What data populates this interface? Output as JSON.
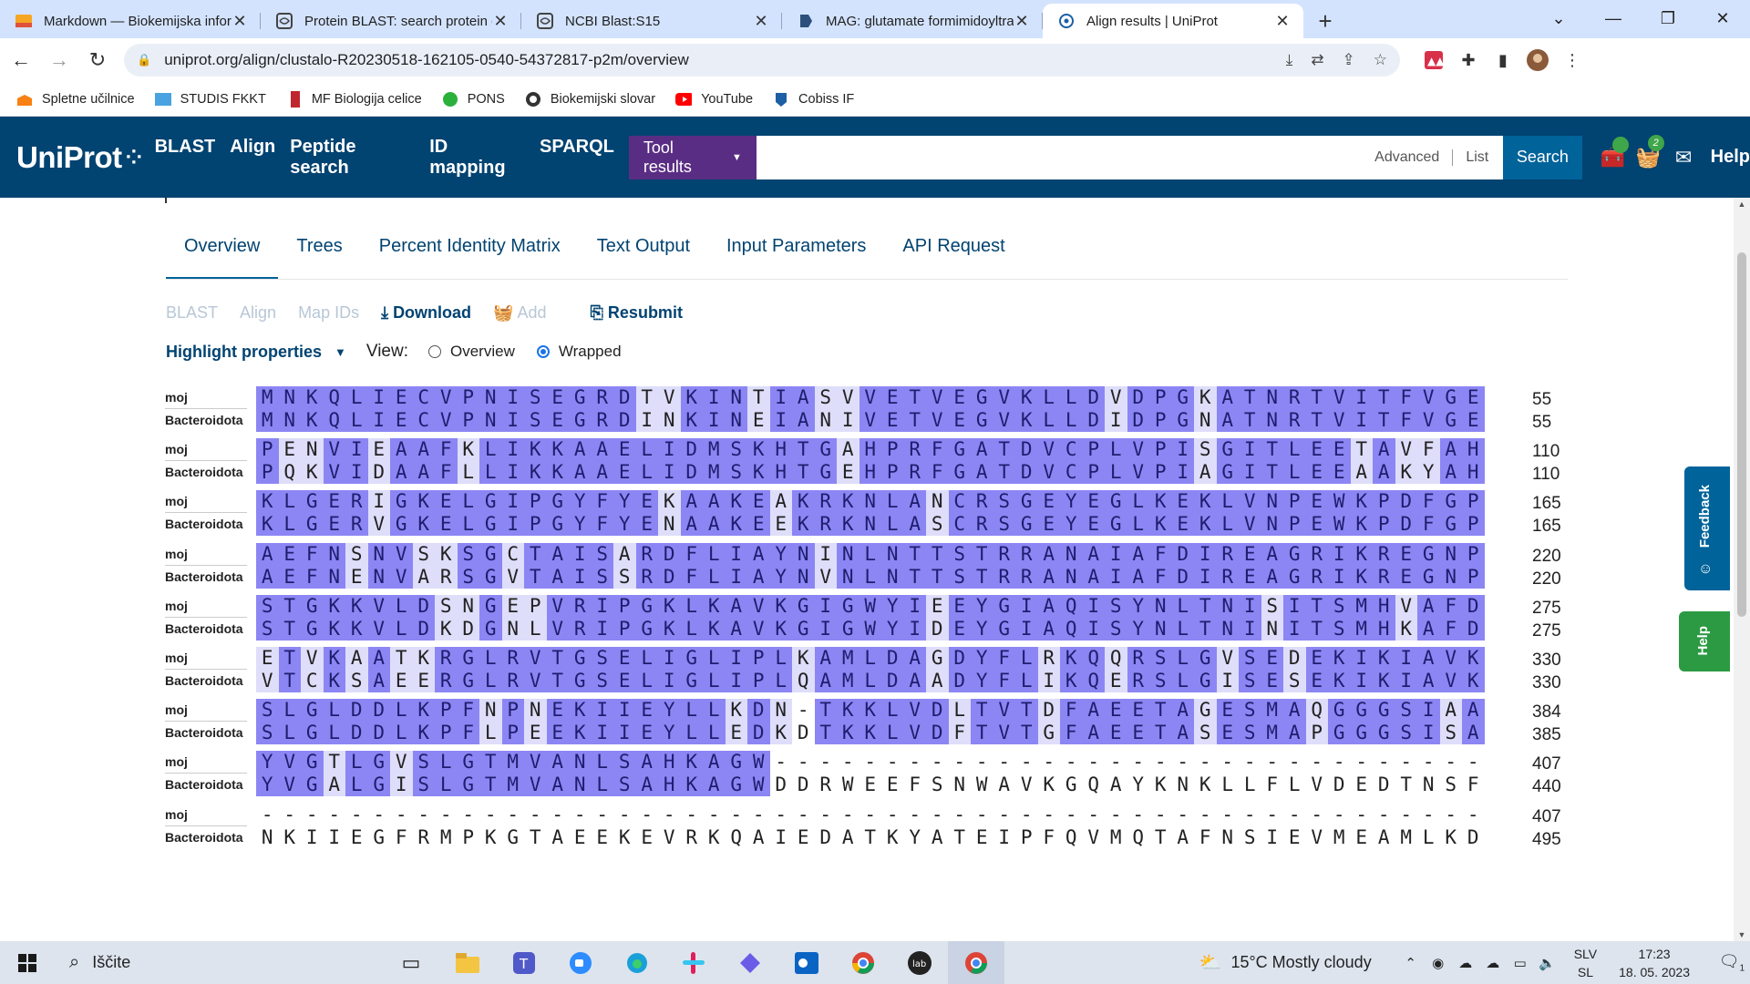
{
  "browser": {
    "tabs": [
      {
        "title": "Markdown — Biokemijska inform",
        "icon": "markdown-icon",
        "active": false
      },
      {
        "title": "Protein BLAST: search protein da",
        "icon": "ncbi-icon",
        "active": false
      },
      {
        "title": "NCBI Blast:S15",
        "icon": "ncbi-icon",
        "active": false
      },
      {
        "title": "MAG: glutamate formimidoyltran",
        "icon": "document-icon",
        "active": false
      },
      {
        "title": "Align results | UniProt",
        "icon": "uniprot-icon",
        "active": true
      }
    ],
    "url": "uniprot.org/align/clustalo-R20230518-162105-0540-54372817-p2m/overview",
    "bookmarks": [
      {
        "label": "Spletne učilnice",
        "icon": "moodle-icon"
      },
      {
        "label": "STUDIS FKKT",
        "icon": "folder-icon"
      },
      {
        "label": "MF Biologija celice",
        "icon": "bookmark-icon"
      },
      {
        "label": "PONS",
        "icon": "pons-icon"
      },
      {
        "label": "Biokemijski slovar",
        "icon": "globe-icon"
      },
      {
        "label": "YouTube",
        "icon": "youtube-icon"
      },
      {
        "label": "Cobiss IF",
        "icon": "cobiss-icon"
      }
    ]
  },
  "uniprot": {
    "logo": "UniProt",
    "nav": [
      "BLAST",
      "Align",
      "Peptide search",
      "ID mapping",
      "SPARQL"
    ],
    "tool_results": "Tool results",
    "search_links": [
      "Advanced",
      "List"
    ],
    "search_button": "Search",
    "basket_count": "2",
    "help": "Help"
  },
  "page": {
    "subtabs": [
      "Overview",
      "Trees",
      "Percent Identity Matrix",
      "Text Output",
      "Input Parameters",
      "API Request"
    ],
    "actions": [
      {
        "label": "BLAST",
        "enabled": false
      },
      {
        "label": "Align",
        "enabled": false
      },
      {
        "label": "Map IDs",
        "enabled": false
      },
      {
        "label": "Download",
        "enabled": true,
        "icon": "download-icon"
      },
      {
        "label": "Add",
        "enabled": false,
        "icon": "basket-icon"
      },
      {
        "label": "Resubmit",
        "enabled": true,
        "icon": "resubmit-icon"
      }
    ],
    "highlight": "Highlight properties",
    "view_label": "View:",
    "view_options": [
      {
        "label": "Overview",
        "selected": false
      },
      {
        "label": "Wrapped",
        "selected": true
      }
    ],
    "feedback": "Feedback",
    "help_tab": "Help"
  },
  "alignment": {
    "names": [
      "moj",
      "Bacteroidota"
    ],
    "blocks": [
      {
        "a": "MNKQLIECVPNISEGRDTVKINTIASVVETVEGVKLLDVDPGKATNRTVITFVGE",
        "b": "MNKQLIECVPNISEGRDINKINEIANIVETVEGVKLLDIDPGNATNRTVITFVGE",
        "na": "55",
        "nb": "55"
      },
      {
        "a": "PENVIEAAFKLIKKAAELIDMSKHTGAHPRFGATDVCPLVPISGITLEETAVFAH",
        "b": "PQKVIDAAFLLIKKAAELIDMSKHTGEHPRFGATDVCPLVPIAGITLEEAAKYAH",
        "na": "110",
        "nb": "110"
      },
      {
        "a": "KLGERIGKELGIPGYFYEKAAKEAKRKNLANCRSGEYEGLKEKLVNPEWKPDFGP",
        "b": "KLGERVGKELGIPGYFYENAAKEEKRKNLASCRSGEYEGLKEKLVNPEWKPDFGP",
        "na": "165",
        "nb": "165"
      },
      {
        "a": "AEFNSNVSKSGCTAISARDFLIAYNINLNTTSTRRANAIAFDIREAGRIKREGNP",
        "b": "AEFNENVARSGVTAISSRDFLIAYNVNLNTTSTRRANAIAFDIREAGRIKREGNP",
        "na": "220",
        "nb": "220"
      },
      {
        "a": "STGKKVLDSNGEPVRIPGKLKAVKGIGWYIEEYGIAQISYNLTNISITSMHVAFD",
        "b": "STGKKVLDKDGNLVRIPGKLKAVKGIGWYIDEYGIAQISYNLTNINITSMHKAFD",
        "na": "275",
        "nb": "275"
      },
      {
        "a": "ETVKAATKRGLRVTGSELIGLIPLKAMLDAGDYFLRKQQRSLGVSEDEKIKIAVK",
        "b": "VTCKSAEERGLRVTGSELIGLIPLQAMLDAADYFLIKQERSLGISESEKIKIAVK",
        "na": "330",
        "nb": "330"
      },
      {
        "a": "SLGLDDLKPFNPNEKIIEYLLKDN-TKKLVDLTVTDFAEETAGESMAQGGGSIAA",
        "b": "SLGLDDLKPFLPEEKIIEYLLEDKDTKKLVDFTVTGFAEETASESMAPGGGSISA",
        "na": "384",
        "nb": "385"
      },
      {
        "a": "YVGTLGVSLGTMVANLSAHKAGW--------------------------------",
        "b": "YVGALGISLGTMVANLSAHKAGWDDRWEEFSNWAVKGQAYKNKLLFLVDEDTNSF",
        "na": "407",
        "nb": "440"
      },
      {
        "a": "-------------------------------------------------------",
        "b": "NKIIEGFRMPKGTAEEKEVRKQAIEDATKYATEIPFQVMQTAFNSIEVMEAMLKD",
        "na": "407",
        "nb": "495"
      }
    ]
  },
  "taskbar": {
    "search_placeholder": "Iščite",
    "weather": "15°C  Mostly cloudy",
    "lang_top": "SLV",
    "lang_bottom": "SL",
    "time": "17:23",
    "date": "18. 05. 2023",
    "notif_count": "1"
  },
  "colors": {
    "uniprot_blue": "#014371",
    "tool_purple": "#5a2d84",
    "identity": "#8c86f4",
    "feedback": "#00639a",
    "help_green": "#2b9a43"
  }
}
